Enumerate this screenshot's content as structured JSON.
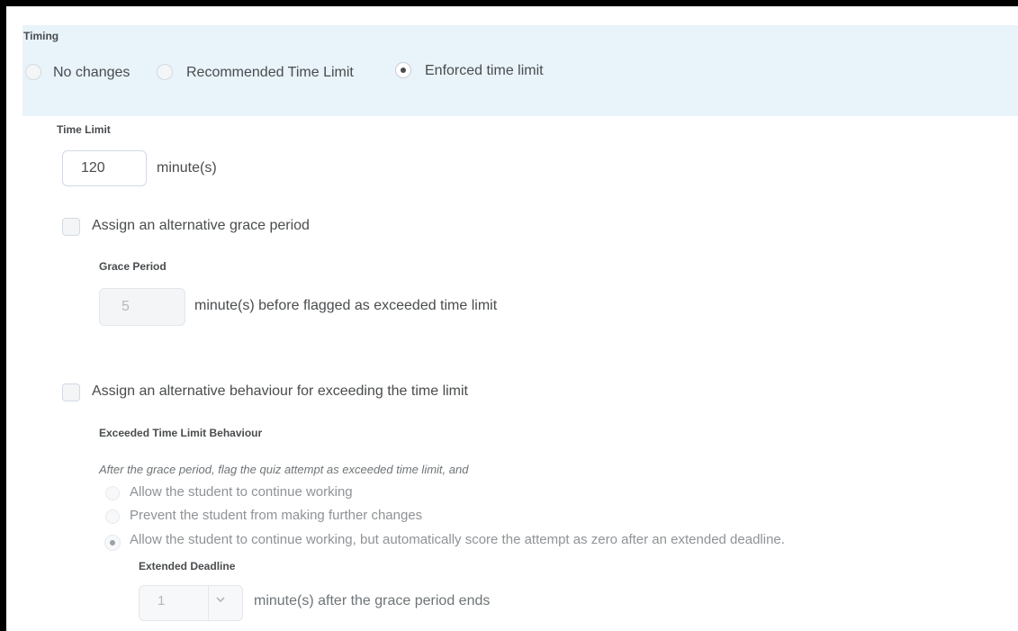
{
  "timing": {
    "heading": "Timing",
    "options": [
      {
        "label": "No changes",
        "selected": false
      },
      {
        "label": "Recommended Time Limit",
        "selected": false
      },
      {
        "label": "Enforced time limit",
        "selected": true
      }
    ]
  },
  "time_limit": {
    "heading": "Time Limit",
    "value": "120",
    "unit": "minute(s)"
  },
  "grace": {
    "checkbox_label": "Assign an alternative grace period",
    "checked": false,
    "heading": "Grace Period",
    "value": "5",
    "suffix": "minute(s) before flagged as exceeded time limit"
  },
  "behaviour": {
    "checkbox_label": "Assign an alternative behaviour for exceeding the time limit",
    "checked": false,
    "heading": "Exceeded Time Limit Behaviour",
    "description": "After the grace period, flag the quiz attempt as exceeded time limit, and",
    "options": [
      {
        "label": "Allow the student to continue working",
        "selected": false
      },
      {
        "label": "Prevent the student from making further changes",
        "selected": false
      },
      {
        "label": "Allow the student to continue working, but automatically score the attempt as zero after an extended deadline.",
        "selected": true
      }
    ],
    "extended_deadline": {
      "heading": "Extended Deadline",
      "value": "1",
      "suffix": "minute(s) after the grace period ends"
    }
  }
}
